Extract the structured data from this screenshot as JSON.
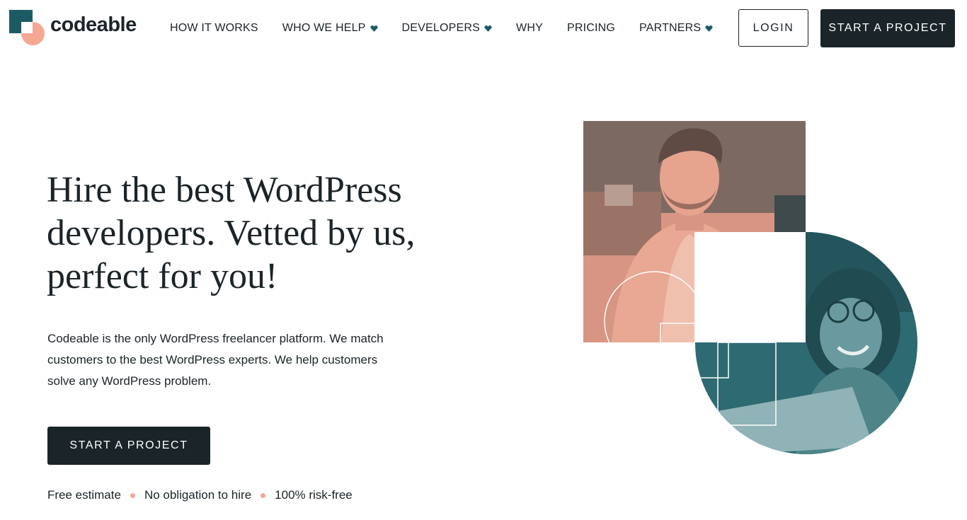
{
  "brand": {
    "name": "codeable",
    "colors": {
      "teal": "#1d5b64",
      "peach": "#f4a894",
      "dark": "#1b2428"
    }
  },
  "nav": {
    "items": [
      {
        "label": "HOW IT WORKS",
        "has_dropdown": false
      },
      {
        "label": "WHO WE HELP",
        "has_dropdown": true
      },
      {
        "label": "DEVELOPERS",
        "has_dropdown": true
      },
      {
        "label": "WHY",
        "has_dropdown": false
      },
      {
        "label": "PRICING",
        "has_dropdown": false
      },
      {
        "label": "PARTNERS",
        "has_dropdown": true
      }
    ],
    "login_label": "LOGIN",
    "start_project_label": "START A PROJECT"
  },
  "hero": {
    "title_lines": [
      "Hire the best WordPress",
      "developers. Vetted by us,",
      "perfect for you!"
    ],
    "description": "Codeable is the only WordPress freelancer platform. We match customers to the best WordPress experts. We help customers solve any WordPress problem.",
    "cta_label": "START A PROJECT",
    "perks": [
      "Free estimate",
      "No obligation to hire",
      "100% risk-free"
    ]
  }
}
